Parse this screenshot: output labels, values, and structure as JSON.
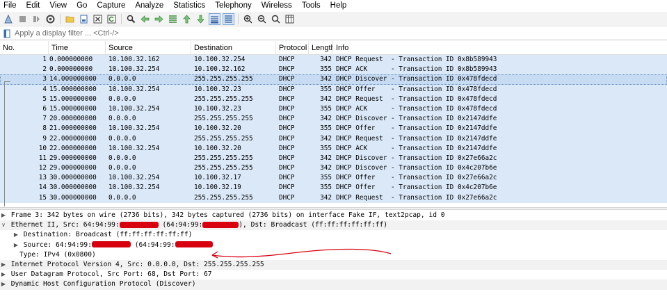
{
  "menu": [
    "File",
    "Edit",
    "View",
    "Go",
    "Capture",
    "Analyze",
    "Statistics",
    "Telephony",
    "Wireless",
    "Tools",
    "Help"
  ],
  "toolbar_icons": [
    "shark-fin-start-icon",
    "stop-square-icon",
    "restart-icon",
    "options-gear-icon",
    "open-folder-icon",
    "save-file-icon",
    "close-file-icon",
    "reload-icon",
    "find-magnifier-icon",
    "go-back-icon",
    "go-forward-icon",
    "go-to-packet-icon",
    "go-first-icon",
    "go-last-icon",
    "autoscroll-icon",
    "colorize-icon",
    "zoom-in-icon",
    "zoom-out-icon",
    "zoom-normal-icon",
    "resize-columns-icon"
  ],
  "filter": {
    "placeholder": "Apply a display filter ... <Ctrl-/>"
  },
  "columns": {
    "no": "No.",
    "time": "Time",
    "source": "Source",
    "destination": "Destination",
    "protocol": "Protocol",
    "length": "Length",
    "info": "Info"
  },
  "packets": [
    {
      "no": "1",
      "time": "0.000000000",
      "src": "10.100.32.162",
      "dst": "10.100.32.254",
      "proto": "DHCP",
      "len": "342",
      "info": "DHCP Request  - Transaction ID 0x8b589943"
    },
    {
      "no": "2",
      "time": "0.000000000",
      "src": "10.100.32.254",
      "dst": "10.100.32.162",
      "proto": "DHCP",
      "len": "355",
      "info": "DHCP ACK      - Transaction ID 0x8b589943"
    },
    {
      "no": "3",
      "time": "14.000000000",
      "src": "0.0.0.0",
      "dst": "255.255.255.255",
      "proto": "DHCP",
      "len": "342",
      "info": "DHCP Discover - Transaction ID 0x478fdecd"
    },
    {
      "no": "4",
      "time": "15.000000000",
      "src": "10.100.32.254",
      "dst": "10.100.32.23",
      "proto": "DHCP",
      "len": "355",
      "info": "DHCP Offer    - Transaction ID 0x478fdecd"
    },
    {
      "no": "5",
      "time": "15.000000000",
      "src": "0.0.0.0",
      "dst": "255.255.255.255",
      "proto": "DHCP",
      "len": "342",
      "info": "DHCP Request  - Transaction ID 0x478fdecd"
    },
    {
      "no": "6",
      "time": "15.000000000",
      "src": "10.100.32.254",
      "dst": "10.100.32.23",
      "proto": "DHCP",
      "len": "355",
      "info": "DHCP ACK      - Transaction ID 0x478fdecd"
    },
    {
      "no": "7",
      "time": "20.000000000",
      "src": "0.0.0.0",
      "dst": "255.255.255.255",
      "proto": "DHCP",
      "len": "342",
      "info": "DHCP Discover - Transaction ID 0x2147ddfe"
    },
    {
      "no": "8",
      "time": "21.000000000",
      "src": "10.100.32.254",
      "dst": "10.100.32.20",
      "proto": "DHCP",
      "len": "355",
      "info": "DHCP Offer    - Transaction ID 0x2147ddfe"
    },
    {
      "no": "9",
      "time": "22.000000000",
      "src": "0.0.0.0",
      "dst": "255.255.255.255",
      "proto": "DHCP",
      "len": "342",
      "info": "DHCP Request  - Transaction ID 0x2147ddfe"
    },
    {
      "no": "10",
      "time": "22.000000000",
      "src": "10.100.32.254",
      "dst": "10.100.32.20",
      "proto": "DHCP",
      "len": "355",
      "info": "DHCP ACK      - Transaction ID 0x2147ddfe"
    },
    {
      "no": "11",
      "time": "29.000000000",
      "src": "0.0.0.0",
      "dst": "255.255.255.255",
      "proto": "DHCP",
      "len": "342",
      "info": "DHCP Discover - Transaction ID 0x27e66a2c"
    },
    {
      "no": "12",
      "time": "29.000000000",
      "src": "0.0.0.0",
      "dst": "255.255.255.255",
      "proto": "DHCP",
      "len": "342",
      "info": "DHCP Discover - Transaction ID 0x4c207b6e"
    },
    {
      "no": "13",
      "time": "30.000000000",
      "src": "10.100.32.254",
      "dst": "10.100.32.17",
      "proto": "DHCP",
      "len": "355",
      "info": "DHCP Offer    - Transaction ID 0x27e66a2c"
    },
    {
      "no": "14",
      "time": "30.000000000",
      "src": "10.100.32.254",
      "dst": "10.100.32.19",
      "proto": "DHCP",
      "len": "355",
      "info": "DHCP Offer    - Transaction ID 0x4c207b6e"
    },
    {
      "no": "15",
      "time": "30.000000000",
      "src": "0.0.0.0",
      "dst": "255.255.255.255",
      "proto": "DHCP",
      "len": "342",
      "info": "DHCP Request  - Transaction ID 0x27e66a2c"
    }
  ],
  "selected_packet": "3",
  "details": {
    "frame": "Frame 3: 342 bytes on wire (2736 bits), 342 bytes captured (2736 bits) on interface Fake IF, text2pcap, id 0",
    "eth_a": "Ethernet II, Src: 64:94:99:",
    "eth_b": " (64:94:99:",
    "eth_c": "), Dst: Broadcast (ff:ff:ff:ff:ff:ff)",
    "dst": "Destination: Broadcast (ff:ff:ff:ff:ff:ff)",
    "src_a": "Source: 64:94:99:",
    "src_b": " (64:94:99:",
    "type": "Type: IPv4 (0x0800)",
    "ip": "Internet Protocol Version 4, Src: 0.0.0.0, Dst: 255.255.255.255",
    "udp": "User Datagram Protocol, Src Port: 68, Dst Port: 67",
    "dhcp": "Dynamic Host Configuration Protocol (Discover)"
  },
  "colors": {
    "row_bg": "#dae8f8",
    "row_selected_bg": "#c7dcf3",
    "redaction": "#d8000f",
    "annotation_arrow": "#d8000f"
  }
}
